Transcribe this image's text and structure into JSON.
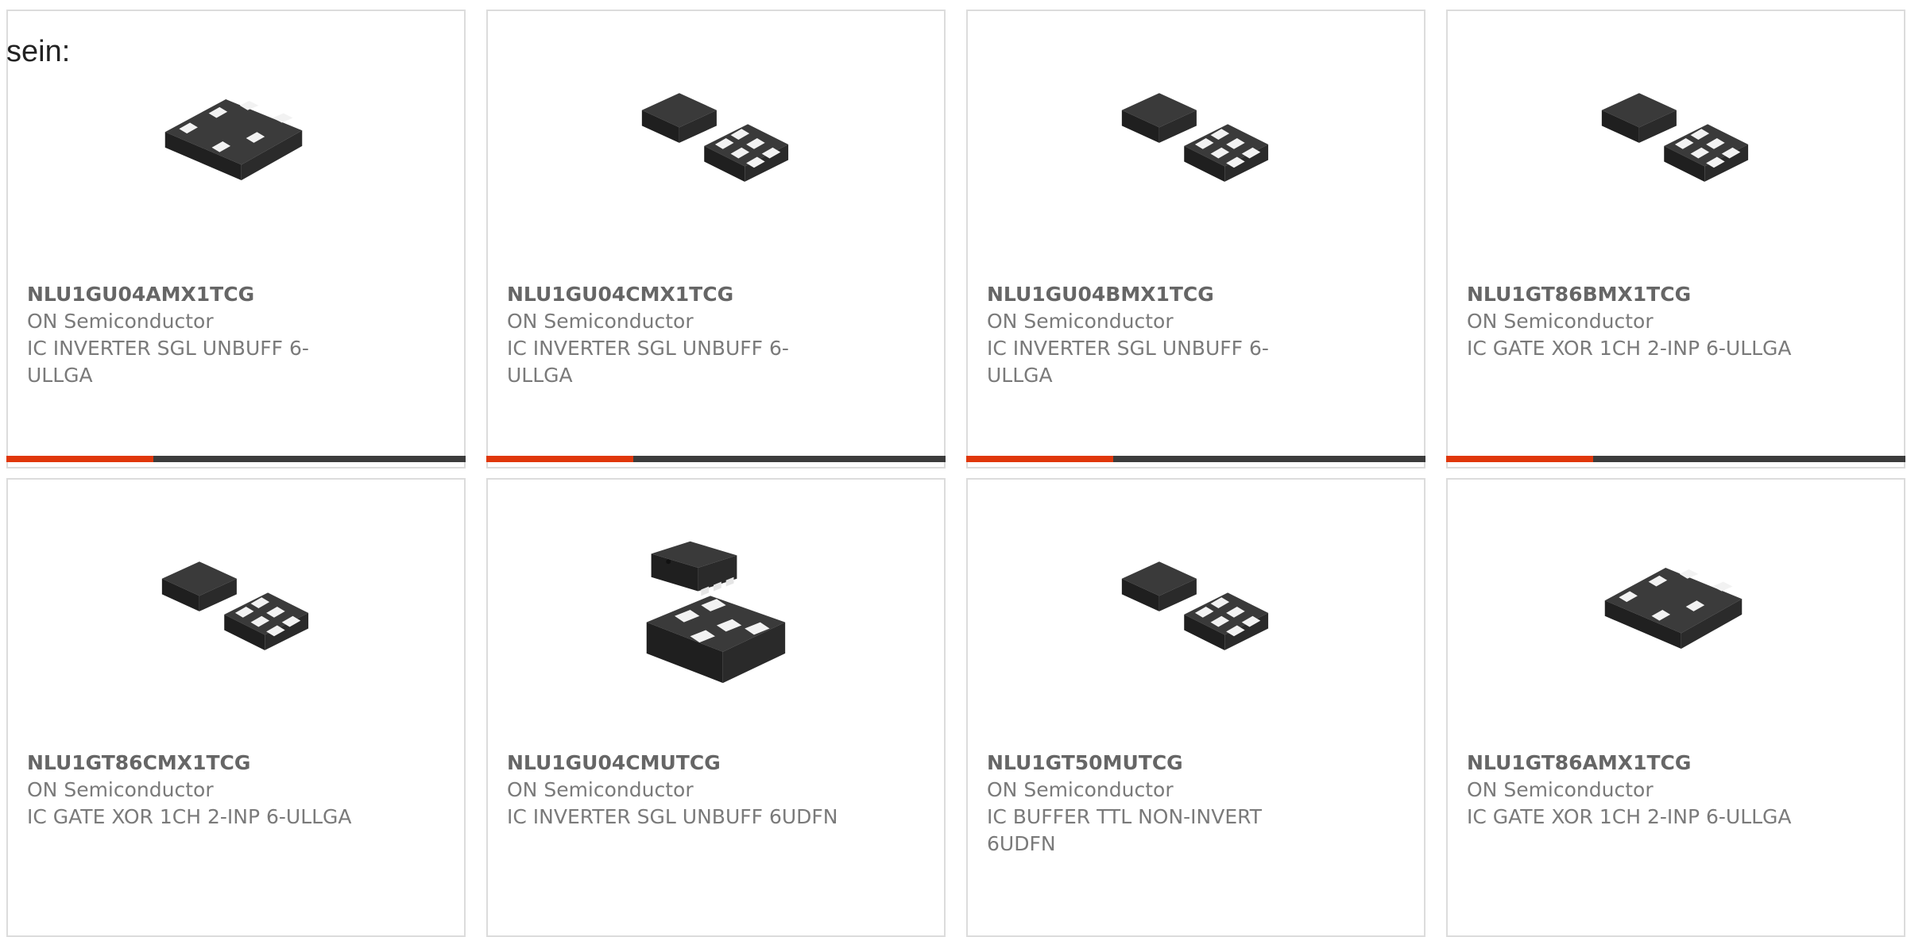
{
  "intro_text": "sein:",
  "accent_color": "#e0370b",
  "bar_color": "#3c3c3c",
  "products": [
    {
      "part_number": "NLU1GU04AMX1TCG",
      "manufacturer": "ON Semiconductor",
      "description": "IC INVERTER SGL UNBUFF 6-ULLGA",
      "image": "ullga-package-top-icon",
      "hover_progress": 0.32
    },
    {
      "part_number": "NLU1GU04CMX1TCG",
      "manufacturer": "ON Semiconductor",
      "description": "IC INVERTER SGL UNBUFF 6-ULLGA",
      "image": "ullga-package-pair-icon",
      "hover_progress": 0.32
    },
    {
      "part_number": "NLU1GU04BMX1TCG",
      "manufacturer": "ON Semiconductor",
      "description": "IC INVERTER SGL UNBUFF 6-ULLGA",
      "image": "ullga-package-pair-icon",
      "hover_progress": 0.32
    },
    {
      "part_number": "NLU1GT86BMX1TCG",
      "manufacturer": "ON Semiconductor",
      "description": "IC GATE XOR 1CH 2-INP 6-ULLGA",
      "image": "ullga-package-pair-icon",
      "hover_progress": 0.32
    },
    {
      "part_number": "NLU1GT86CMX1TCG",
      "manufacturer": "ON Semiconductor",
      "description": "IC GATE XOR 1CH 2-INP 6-ULLGA",
      "image": "ullga-package-pair-icon"
    },
    {
      "part_number": "NLU1GU04CMUTCG",
      "manufacturer": "ON Semiconductor",
      "description": "IC INVERTER SGL UNBUFF 6UDFN",
      "image": "udfn-package-icon"
    },
    {
      "part_number": "NLU1GT50MUTCG",
      "manufacturer": "ON Semiconductor",
      "description": "IC BUFFER TTL NON-INVERT 6UDFN",
      "image": "ullga-package-pair-icon"
    },
    {
      "part_number": "NLU1GT86AMX1TCG",
      "manufacturer": "ON Semiconductor",
      "description": "IC GATE XOR 1CH 2-INP 6-ULLGA",
      "image": "ullga-package-top-icon"
    }
  ]
}
